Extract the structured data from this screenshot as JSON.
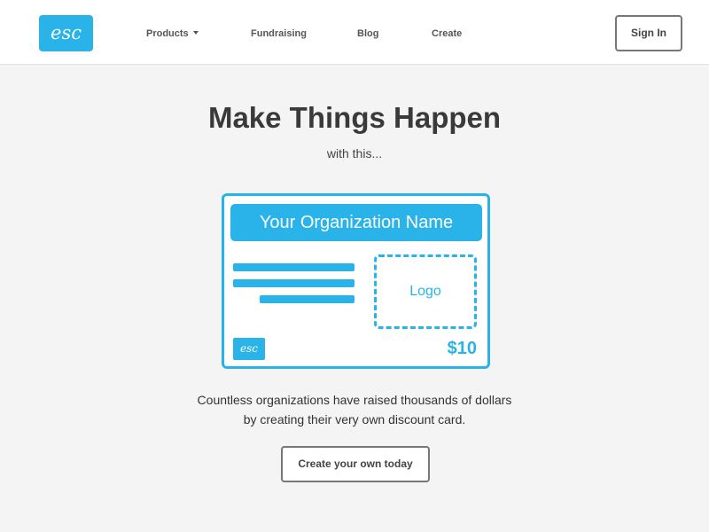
{
  "header": {
    "logo_text": "esc",
    "nav": [
      {
        "label": "Products",
        "has_dropdown": true
      },
      {
        "label": "Fundraising"
      },
      {
        "label": "Blog"
      },
      {
        "label": "Create"
      }
    ],
    "signin_label": "Sign In"
  },
  "hero": {
    "title": "Make Things Happen",
    "subtitle": "with this...",
    "card": {
      "org_name": "Your Organization Name",
      "logo_placeholder": "Logo",
      "badge": "esc",
      "price": "$10"
    },
    "description_line1": "Countless organizations have raised thousands of dollars",
    "description_line2": "by creating their very own discount card.",
    "cta_label": "Create your own today"
  },
  "colors": {
    "accent": "#2ab3e8",
    "background": "#f4f4f4",
    "text": "#3a3a3a"
  }
}
